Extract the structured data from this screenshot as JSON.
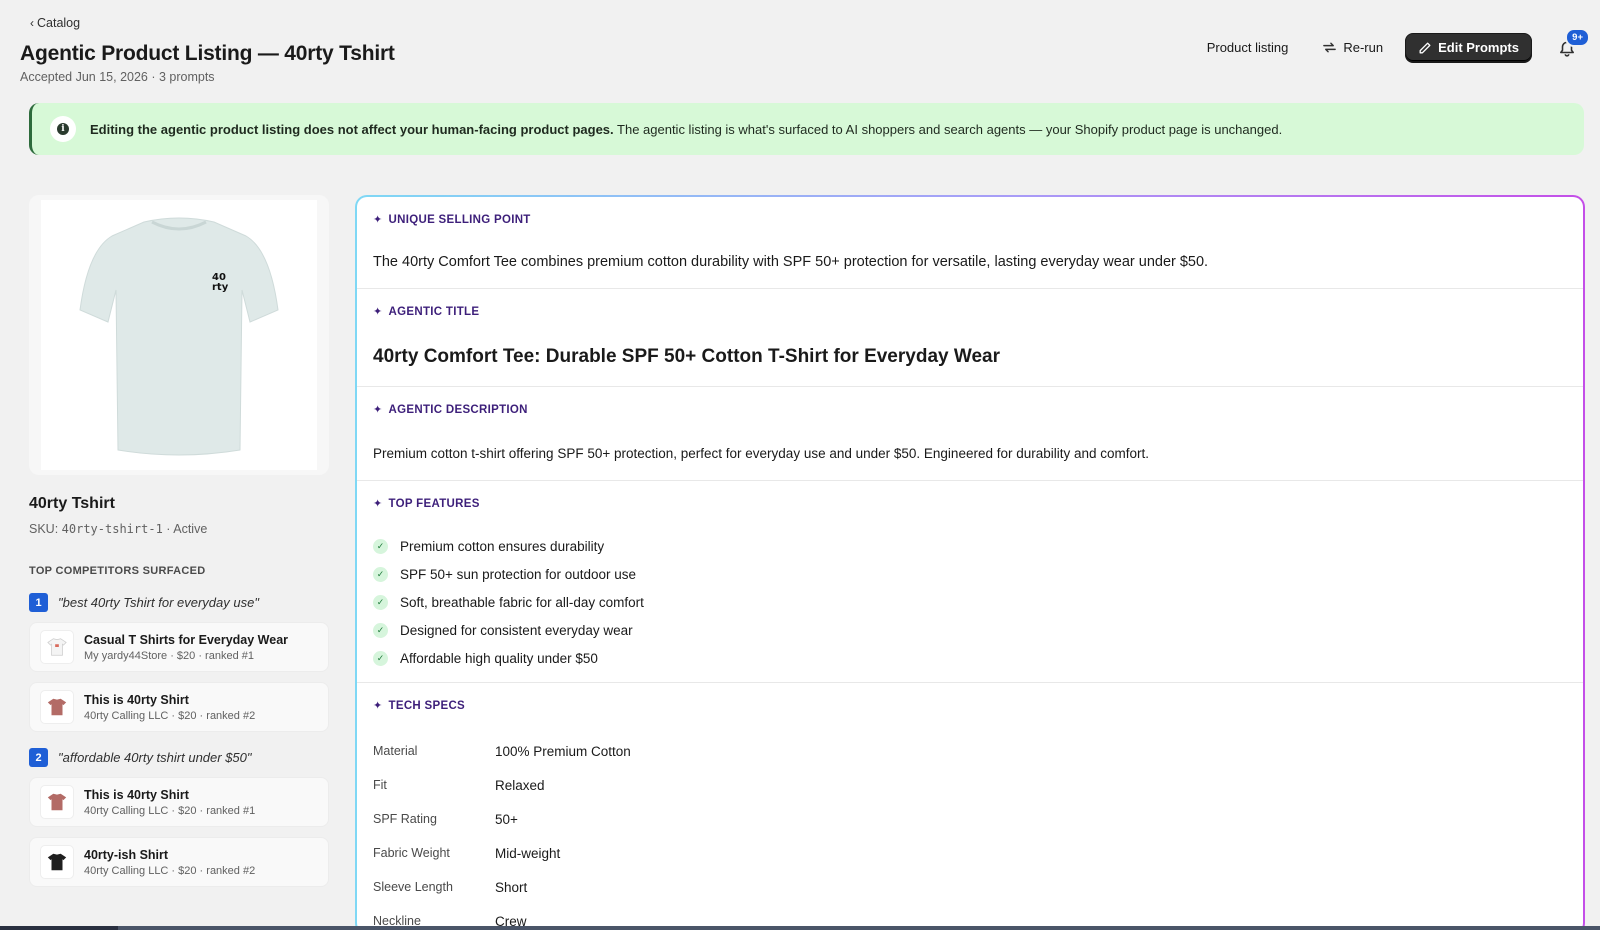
{
  "header": {
    "back_label": "Catalog",
    "title": "Agentic Product Listing — 40rty Tshirt",
    "subtitle": "Accepted Jun 15, 2026 · 3 prompts",
    "actions": {
      "product_listing": "Product listing",
      "rerun": "Re-run",
      "edit_prompts": "Edit Prompts",
      "notification_badge": "9+"
    }
  },
  "banner": {
    "bold": "Editing the agentic product listing does not affect your human-facing product pages.",
    "rest": " The agentic listing is what's surfaced to AI shoppers and search agents — your Shopify product page is unchanged."
  },
  "product": {
    "name": "40rty Tshirt",
    "sku_label": "SKU: ",
    "sku": "40rty-tshirt-1",
    "status": " · Active",
    "logo_text": "40 rty"
  },
  "competitors": {
    "heading": "TOP COMPETITORS SURFACED",
    "queries": [
      {
        "num": "1",
        "text": "\"best 40rty Tshirt for everyday use\"",
        "items": [
          {
            "title": "Casual T Shirts for Everyday Wear",
            "meta": "My yardy44Store · $20 · ranked #1",
            "color": "#ffffff"
          },
          {
            "title": "This is 40rty Shirt",
            "meta": "40rty Calling LLC · $20 · ranked #2",
            "color": "#b36b66"
          }
        ]
      },
      {
        "num": "2",
        "text": "\"affordable 40rty tshirt under $50\"",
        "items": [
          {
            "title": "This is 40rty Shirt",
            "meta": "40rty Calling LLC · $20 · ranked #1",
            "color": "#b36b66"
          },
          {
            "title": "40rty-ish Shirt",
            "meta": "40rty Calling LLC · $20 · ranked #2",
            "color": "#1f1f1f"
          }
        ]
      }
    ]
  },
  "listing": {
    "usp_label": "UNIQUE SELLING POINT",
    "usp": "The 40rty Comfort Tee combines premium cotton durability with SPF 50+ protection for versatile, lasting everyday wear under $50.",
    "title_label": "AGENTIC TITLE",
    "title": "40rty Comfort Tee: Durable SPF 50+ Cotton T-Shirt for Everyday Wear",
    "desc_label": "AGENTIC DESCRIPTION",
    "desc": "Premium cotton t-shirt offering SPF 50+ protection, perfect for everyday use and under $50. Engineered for durability and comfort.",
    "features_label": "TOP FEATURES",
    "features": [
      "Premium cotton ensures durability",
      "SPF 50+ sun protection for outdoor use",
      "Soft, breathable fabric for all-day comfort",
      "Designed for consistent everyday wear",
      "Affordable high quality under $50"
    ],
    "specs_label": "TECH SPECS",
    "specs": [
      {
        "k": "Material",
        "v": "100% Premium Cotton"
      },
      {
        "k": "Fit",
        "v": "Relaxed"
      },
      {
        "k": "SPF Rating",
        "v": "50+"
      },
      {
        "k": "Fabric Weight",
        "v": "Mid-weight"
      },
      {
        "k": "Sleeve Length",
        "v": "Short"
      },
      {
        "k": "Neckline",
        "v": "Crew"
      }
    ]
  },
  "colors": {
    "shirt_main": "#dfe9e8",
    "accent_blue": "#1f5fd6",
    "label_purple": "#3d1f7a",
    "banner_bg": "#d7f9d7"
  }
}
